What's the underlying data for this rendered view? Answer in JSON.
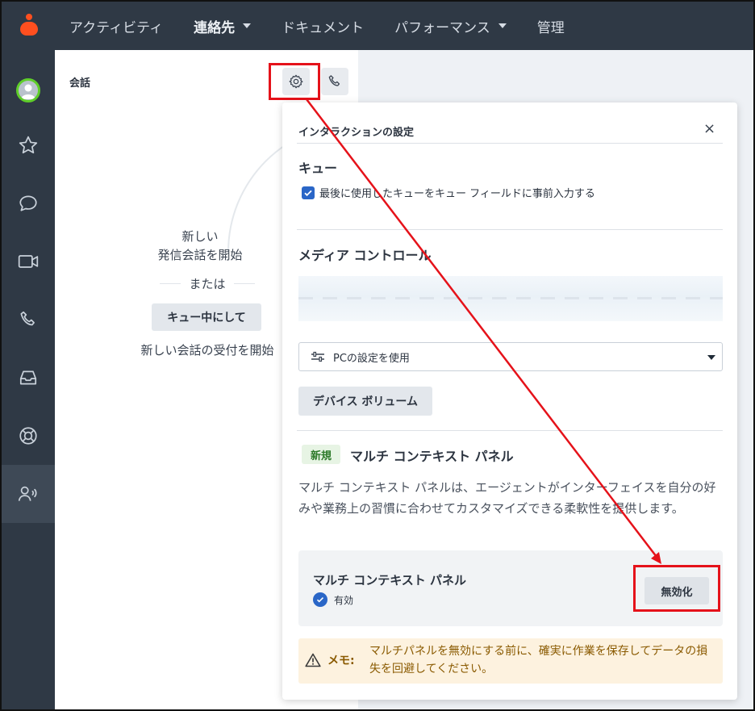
{
  "nav": {
    "items": [
      {
        "label": "アクティビティ",
        "bold": false,
        "caret": false
      },
      {
        "label": "連絡先",
        "bold": true,
        "caret": true
      },
      {
        "label": "ドキュメント",
        "bold": false,
        "caret": false
      },
      {
        "label": "パフォーマンス",
        "bold": false,
        "caret": true
      },
      {
        "label": "管理",
        "bold": false,
        "caret": false
      }
    ]
  },
  "rail": {
    "icons": [
      "avatar",
      "star-icon",
      "chat-icon",
      "video-icon",
      "phone-icon",
      "inbox-icon",
      "lifebuoy-icon",
      "agent-voice-icon"
    ]
  },
  "conversation": {
    "title": "会話",
    "start_new_line1": "新しい",
    "start_new_line2": "発信会話を開始",
    "or": "または",
    "queue_button": "キュー中にして",
    "start_receive": "新しい会話の受付を開始"
  },
  "settings": {
    "title": "インタラクションの設定",
    "close": "×",
    "queue_heading": "キュー",
    "queue_checkbox_label": "最後に使用したキューをキュー フィールドに事前入力する",
    "queue_checked": true,
    "media_heading": "メディア コントロール",
    "device_select_value": "PCの設定を使用",
    "device_volume_button": "デバイス ボリューム",
    "new_badge": "新規",
    "multi_context_heading": "マルチ コンテキスト パネル",
    "multi_context_desc": "マルチ コンテキスト パネルは、エージェントがインターフェイスを自分の好みや業務上の習慣に合わせてカスタマイズできる柔軟性を提供します。",
    "card_title": "マルチ コンテキスト パネル",
    "card_status": "有効",
    "disable_button": "無効化",
    "memo_label": "メモ:",
    "memo_text": "マルチパネルを無効にする前に、確実に作業を保存してデータの損失を回避してください。"
  },
  "colors": {
    "nav_bg": "#2f3945",
    "brand": "#ff4f1f",
    "highlight": "#e5121a",
    "accent": "#2a66c7",
    "memo_bg": "#fdf2df"
  }
}
